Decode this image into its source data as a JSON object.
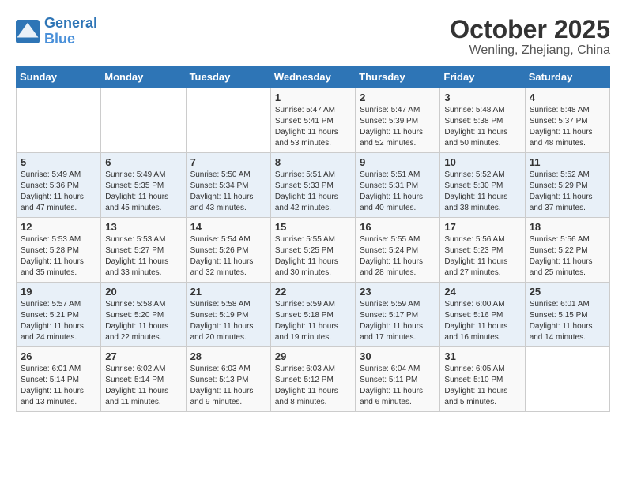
{
  "header": {
    "logo_line1": "General",
    "logo_line2": "Blue",
    "title": "October 2025",
    "subtitle": "Wenling, Zhejiang, China"
  },
  "weekdays": [
    "Sunday",
    "Monday",
    "Tuesday",
    "Wednesday",
    "Thursday",
    "Friday",
    "Saturday"
  ],
  "weeks": [
    [
      {
        "day": "",
        "info": ""
      },
      {
        "day": "",
        "info": ""
      },
      {
        "day": "",
        "info": ""
      },
      {
        "day": "1",
        "info": "Sunrise: 5:47 AM\nSunset: 5:41 PM\nDaylight: 11 hours\nand 53 minutes."
      },
      {
        "day": "2",
        "info": "Sunrise: 5:47 AM\nSunset: 5:39 PM\nDaylight: 11 hours\nand 52 minutes."
      },
      {
        "day": "3",
        "info": "Sunrise: 5:48 AM\nSunset: 5:38 PM\nDaylight: 11 hours\nand 50 minutes."
      },
      {
        "day": "4",
        "info": "Sunrise: 5:48 AM\nSunset: 5:37 PM\nDaylight: 11 hours\nand 48 minutes."
      }
    ],
    [
      {
        "day": "5",
        "info": "Sunrise: 5:49 AM\nSunset: 5:36 PM\nDaylight: 11 hours\nand 47 minutes."
      },
      {
        "day": "6",
        "info": "Sunrise: 5:49 AM\nSunset: 5:35 PM\nDaylight: 11 hours\nand 45 minutes."
      },
      {
        "day": "7",
        "info": "Sunrise: 5:50 AM\nSunset: 5:34 PM\nDaylight: 11 hours\nand 43 minutes."
      },
      {
        "day": "8",
        "info": "Sunrise: 5:51 AM\nSunset: 5:33 PM\nDaylight: 11 hours\nand 42 minutes."
      },
      {
        "day": "9",
        "info": "Sunrise: 5:51 AM\nSunset: 5:31 PM\nDaylight: 11 hours\nand 40 minutes."
      },
      {
        "day": "10",
        "info": "Sunrise: 5:52 AM\nSunset: 5:30 PM\nDaylight: 11 hours\nand 38 minutes."
      },
      {
        "day": "11",
        "info": "Sunrise: 5:52 AM\nSunset: 5:29 PM\nDaylight: 11 hours\nand 37 minutes."
      }
    ],
    [
      {
        "day": "12",
        "info": "Sunrise: 5:53 AM\nSunset: 5:28 PM\nDaylight: 11 hours\nand 35 minutes."
      },
      {
        "day": "13",
        "info": "Sunrise: 5:53 AM\nSunset: 5:27 PM\nDaylight: 11 hours\nand 33 minutes."
      },
      {
        "day": "14",
        "info": "Sunrise: 5:54 AM\nSunset: 5:26 PM\nDaylight: 11 hours\nand 32 minutes."
      },
      {
        "day": "15",
        "info": "Sunrise: 5:55 AM\nSunset: 5:25 PM\nDaylight: 11 hours\nand 30 minutes."
      },
      {
        "day": "16",
        "info": "Sunrise: 5:55 AM\nSunset: 5:24 PM\nDaylight: 11 hours\nand 28 minutes."
      },
      {
        "day": "17",
        "info": "Sunrise: 5:56 AM\nSunset: 5:23 PM\nDaylight: 11 hours\nand 27 minutes."
      },
      {
        "day": "18",
        "info": "Sunrise: 5:56 AM\nSunset: 5:22 PM\nDaylight: 11 hours\nand 25 minutes."
      }
    ],
    [
      {
        "day": "19",
        "info": "Sunrise: 5:57 AM\nSunset: 5:21 PM\nDaylight: 11 hours\nand 24 minutes."
      },
      {
        "day": "20",
        "info": "Sunrise: 5:58 AM\nSunset: 5:20 PM\nDaylight: 11 hours\nand 22 minutes."
      },
      {
        "day": "21",
        "info": "Sunrise: 5:58 AM\nSunset: 5:19 PM\nDaylight: 11 hours\nand 20 minutes."
      },
      {
        "day": "22",
        "info": "Sunrise: 5:59 AM\nSunset: 5:18 PM\nDaylight: 11 hours\nand 19 minutes."
      },
      {
        "day": "23",
        "info": "Sunrise: 5:59 AM\nSunset: 5:17 PM\nDaylight: 11 hours\nand 17 minutes."
      },
      {
        "day": "24",
        "info": "Sunrise: 6:00 AM\nSunset: 5:16 PM\nDaylight: 11 hours\nand 16 minutes."
      },
      {
        "day": "25",
        "info": "Sunrise: 6:01 AM\nSunset: 5:15 PM\nDaylight: 11 hours\nand 14 minutes."
      }
    ],
    [
      {
        "day": "26",
        "info": "Sunrise: 6:01 AM\nSunset: 5:14 PM\nDaylight: 11 hours\nand 13 minutes."
      },
      {
        "day": "27",
        "info": "Sunrise: 6:02 AM\nSunset: 5:14 PM\nDaylight: 11 hours\nand 11 minutes."
      },
      {
        "day": "28",
        "info": "Sunrise: 6:03 AM\nSunset: 5:13 PM\nDaylight: 11 hours\nand 9 minutes."
      },
      {
        "day": "29",
        "info": "Sunrise: 6:03 AM\nSunset: 5:12 PM\nDaylight: 11 hours\nand 8 minutes."
      },
      {
        "day": "30",
        "info": "Sunrise: 6:04 AM\nSunset: 5:11 PM\nDaylight: 11 hours\nand 6 minutes."
      },
      {
        "day": "31",
        "info": "Sunrise: 6:05 AM\nSunset: 5:10 PM\nDaylight: 11 hours\nand 5 minutes."
      },
      {
        "day": "",
        "info": ""
      }
    ]
  ]
}
